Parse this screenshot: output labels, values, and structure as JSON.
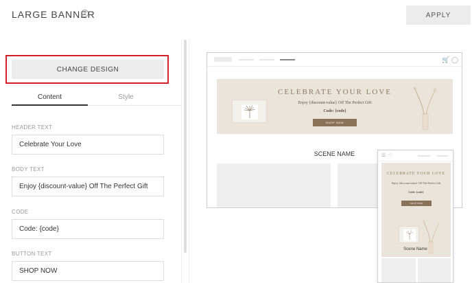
{
  "header": {
    "title": "LARGE BANNER",
    "help_icon": "?",
    "apply_label": "APPLY"
  },
  "left_panel": {
    "change_design_label": "CHANGE DESIGN",
    "tabs": [
      {
        "label": "Content",
        "active": true
      },
      {
        "label": "Style",
        "active": false
      }
    ],
    "fields": [
      {
        "label": "HEADER TEXT",
        "value": "Celebrate Your Love"
      },
      {
        "label": "BODY TEXT",
        "value": "Enjoy {discount-value} Off The Perfect Gift"
      },
      {
        "label": "CODE",
        "value": "Code: {code}"
      },
      {
        "label": "BUTTON TEXT",
        "value": "SHOP NOW"
      }
    ]
  },
  "preview": {
    "desktop": {
      "banner_header": "CELEBRATE YOUR LOVE",
      "banner_body": "Enjoy {discount-value} Off The Perfect Gift",
      "banner_code": "Code: {code}",
      "banner_button": "SHOP NOW",
      "scene_name": "SCENE NAME",
      "cart_icon": "cart-icon",
      "user_icon": "user-icon"
    },
    "mobile": {
      "banner_header": "CELEBRATE YOUR LOVE",
      "banner_body": "Enjoy {discount-value} Off The Perfect Gift",
      "banner_code": "Code: {code}",
      "banner_button": "SHOP NOW",
      "scene_name": "Scene Name"
    }
  },
  "colors": {
    "highlight_border": "#d32027",
    "banner_bg": "#ebe4db",
    "banner_button": "#8a7258",
    "banner_heading": "#8a7a66"
  }
}
